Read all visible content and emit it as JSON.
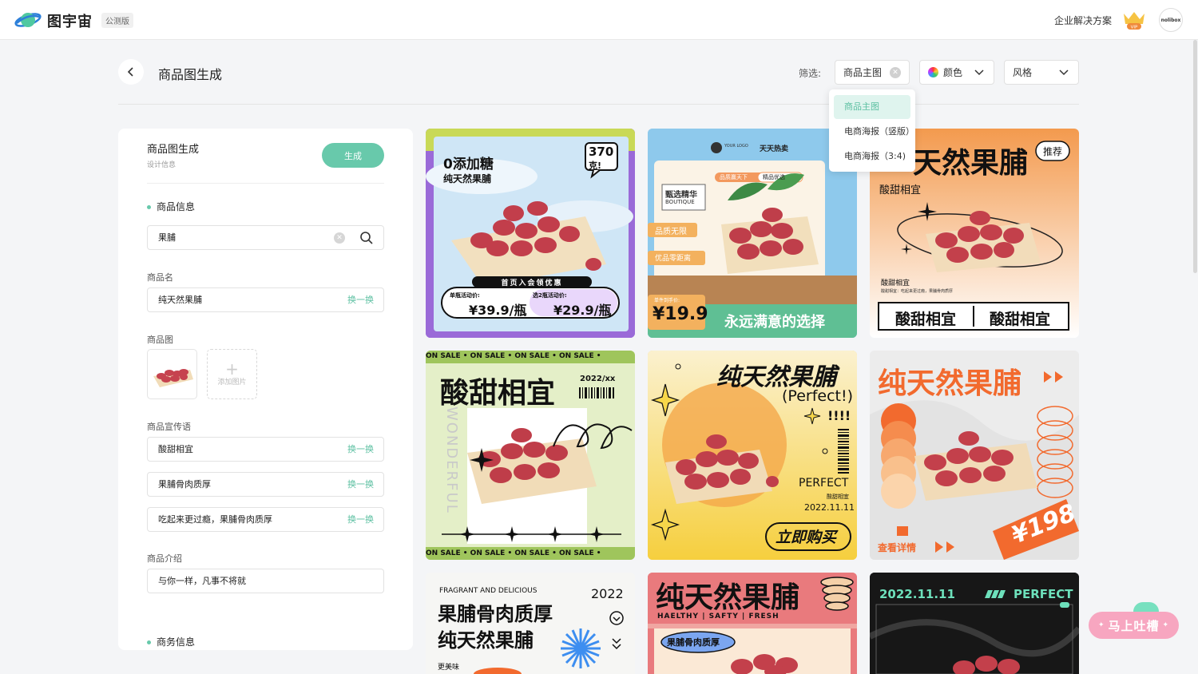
{
  "header": {
    "logo_text": "图宇宙",
    "beta_badge": "公测版",
    "enterprise_link": "企业解决方案",
    "vip_label": "VIP",
    "avatar_text": "nolibox"
  },
  "toolbar": {
    "page_title": "商品图生成",
    "filter_label": "筛选:",
    "filter_type": "商品主图",
    "filter_color": "颜色",
    "filter_style": "风格"
  },
  "dropdown": {
    "items": [
      "商品主图",
      "电商海报（竖版）",
      "电商海报（3:4)"
    ],
    "selected": "商品主图"
  },
  "panel": {
    "title": "商品图生成",
    "subtitle": "设计信息",
    "generate_button": "生成",
    "section_product": "商品信息",
    "search_value": "果脯",
    "product_name_label": "商品名",
    "product_name_value": "纯天然果脯",
    "swap_label": "换一换",
    "product_image_label": "商品图",
    "add_image_label": "添加图片",
    "slogan_label": "商品宣传语",
    "slogans": [
      "酸甜相宜",
      "果脯骨肉质厚",
      "吃起来更过瘾，果脯骨肉质厚"
    ],
    "intro_label": "商品介绍",
    "intro_value": "与你一样，凡事不将就",
    "section_business": "商务信息"
  },
  "cards": {
    "c1": {
      "title": "0添加糖",
      "sub": "纯天然果脯",
      "bubble_num": "370",
      "bubble_unit": "克!",
      "banner": "首页入会领优惠",
      "p1_label": "单瓶活动价:",
      "p1": "¥39.9/瓶",
      "p2_label": "选2瓶活动价:",
      "p2": "¥29.9/瓶"
    },
    "c2": {
      "logo": "YOUR LOGO",
      "hot": "天天热卖",
      "tag1": "品质赢天下",
      "tag2": "精品优选",
      "box1": "甄选精华",
      "box1_en": "BOUTIQUE",
      "f1": "品质无限",
      "f2": "优品零距离",
      "price_label": "单件到手价:",
      "price": "¥19.9",
      "slogan": "永远满意的选择"
    },
    "c3": {
      "title": "天然果脯",
      "tag": "推荐",
      "sub": "酸甜相宜",
      "small_title": "酸甜相宜",
      "small_desc": "酸甜相宜：吃起来更过瘾，果脯骨肉质厚",
      "btn1": "酸甜相宜",
      "btn2": "酸甜相宜"
    },
    "c4": {
      "marquee": "ON SALE • ON SALE • ON SALE • ON SALE •",
      "title": "酸甜相宜",
      "date": "2022/xx",
      "vertical": "WONDERFUL"
    },
    "c5": {
      "title": "纯天然果脯",
      "perfect_sub": "(Perfect!)",
      "bang": "!!!!",
      "perfect": "PERFECT",
      "small": "酸甜相宜",
      "date": "2022.11.11",
      "cta": "立即购买"
    },
    "c6": {
      "title": "纯天然果脯",
      "price": "¥198",
      "details": "查看详情"
    },
    "c7": {
      "en": "FRAGRANT AND DELICIOUS",
      "year": "2022",
      "line1": "果脯骨肉质厚",
      "line2": "纯天然果脯",
      "foot": "更美味"
    },
    "c8": {
      "title": "纯天然果脯",
      "tags": "HAELTHY | SAFTY | FRESH",
      "label": "果脯骨肉质厚"
    },
    "c9": {
      "date": "2022.11.11",
      "perfect": "PERFECT"
    }
  },
  "feedback": {
    "label": "马上吐槽"
  },
  "colors": {
    "accent": "#68c9ab",
    "accent_light": "#dff4ee"
  }
}
